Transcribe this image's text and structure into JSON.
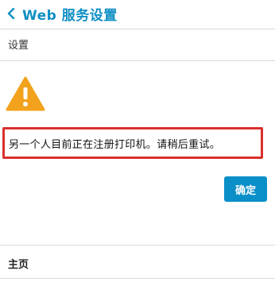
{
  "header": {
    "back_icon": "chevron-left-icon",
    "title": "Web 服务设置",
    "accent_color": "#0f8fc4"
  },
  "section": {
    "label": "设置"
  },
  "alert": {
    "icon": "warning-triangle-icon",
    "icon_color": "#f3a21d",
    "message": "另一个人目前正在注册打印机。请稍后重试。",
    "highlight_color": "#d9302c"
  },
  "actions": {
    "ok_label": "确定",
    "ok_color": "#0a8fc9"
  },
  "footer": {
    "home_label": "主页"
  }
}
